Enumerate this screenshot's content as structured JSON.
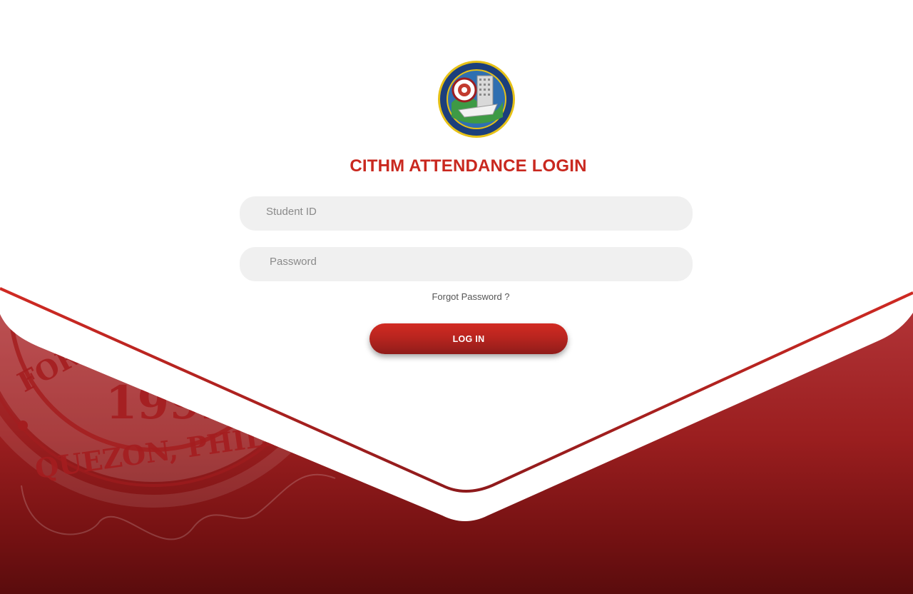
{
  "page": {
    "title": "CITHM ATTENDANCE LOGIN"
  },
  "logo": {
    "name": "cithm-seal-logo",
    "text": "COLLEGE OF INTERNATIONAL TOURISM AND HOSPITALITY MANAGEMENT"
  },
  "form": {
    "student_id_placeholder": "Student ID",
    "student_id_value": "",
    "password_placeholder": "Password",
    "password_value": "",
    "forgot_label": "Forgot Password ?",
    "login_label": "LOG IN"
  },
  "background_seal": {
    "arc_text_top": "FOR C",
    "year": "1992",
    "arc_text_bottom": "QUEZON, PHILIPPINE"
  },
  "colors": {
    "brand_red": "#c9281f",
    "dark_red": "#6e1010",
    "input_bg": "#f0f0f0"
  }
}
